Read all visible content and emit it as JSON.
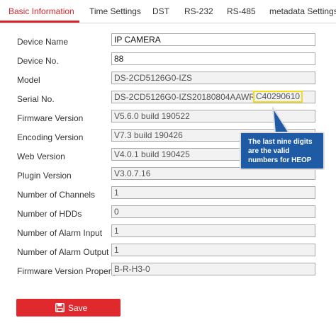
{
  "tabs": [
    {
      "label": "Basic Information",
      "active": true
    },
    {
      "label": "Time Settings"
    },
    {
      "label": "DST"
    },
    {
      "label": "RS-232"
    },
    {
      "label": "RS-485"
    },
    {
      "label": "metadata Settings"
    }
  ],
  "fields": {
    "device_name": {
      "label": "Device Name",
      "value": "IP CAMERA"
    },
    "device_no": {
      "label": "Device No.",
      "value": "88"
    },
    "model": {
      "label": "Model",
      "value": "DS-2CD5126G0-IZS"
    },
    "serial_no": {
      "label": "Serial No.",
      "value_prefix": "DS-2CD5126G0-IZS20180804AAWR",
      "value_highlight": "C40290610"
    },
    "firmware_version": {
      "label": "Firmware Version",
      "value": "V5.6.0 build 190522"
    },
    "encoding_version": {
      "label": "Encoding Version",
      "value": "V7.3 build 190426"
    },
    "web_version": {
      "label": "Web Version",
      "value": "V4.0.1 build 190425"
    },
    "plugin_version": {
      "label": "Plugin Version",
      "value": "V3.0.7.16"
    },
    "number_of_channels": {
      "label": "Number of Channels",
      "value": "1"
    },
    "number_of_hdds": {
      "label": "Number of HDDs",
      "value": "0"
    },
    "number_of_alarm_input": {
      "label": "Number of Alarm Input",
      "value": "1"
    },
    "number_of_alarm_output": {
      "label": "Number of Alarm Output",
      "value": "1"
    },
    "firmware_version_property": {
      "label": "Firmware Version Property",
      "value": "B-R-H3-0"
    }
  },
  "callout": {
    "lines": [
      "The last nine digits",
      "are the valid",
      "numbers for HEOP"
    ]
  },
  "save_button": {
    "label": "Save",
    "icon": "floppy-disk-icon"
  },
  "colors": {
    "accent": "#d6262b",
    "callout_bg": "#1f5ba4",
    "highlight_border": "#f1dc1c"
  }
}
